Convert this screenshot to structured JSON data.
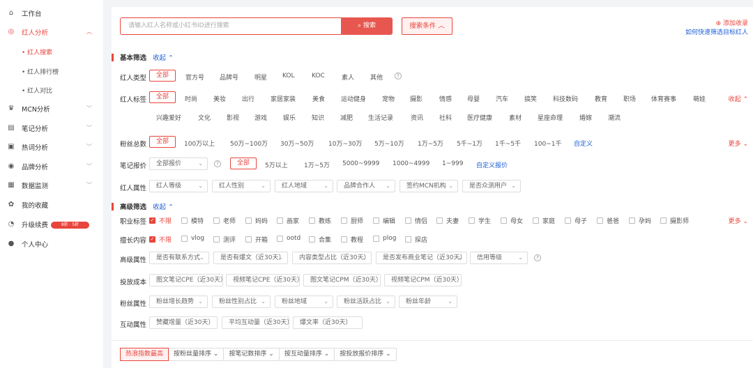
{
  "sidebar": {
    "items": [
      {
        "label": "工作台",
        "icon": "home-icon"
      },
      {
        "label": "红人分析",
        "icon": "target-icon"
      },
      {
        "label": "MCN分析",
        "icon": "crown-icon"
      },
      {
        "label": "笔记分析",
        "icon": "note-icon"
      },
      {
        "label": "热词分析",
        "icon": "fire-icon"
      },
      {
        "label": "品牌分析",
        "icon": "brand-icon"
      },
      {
        "label": "数据监测",
        "icon": "monitor-icon"
      },
      {
        "label": "我的收藏",
        "icon": "star-icon"
      },
      {
        "label": "升级续费",
        "icon": "upgrade-icon"
      },
      {
        "label": "个人中心",
        "icon": "user-icon"
      }
    ],
    "sub_items": [
      "• 红人搜索",
      "• 红人排行榜",
      "• 红人对比"
    ],
    "badge": "8折 · 5折"
  },
  "search": {
    "placeholder": "请输入红人名称或小红书ID进行搜索",
    "button": "⌕ 搜索",
    "condition_button": "搜索条件",
    "add_fav": "⊕ 添加收录",
    "quick_link": "如何快速筛选目标红人"
  },
  "basic": {
    "title": "基本筛选",
    "fold": "收起 ⌃",
    "type": {
      "label": "红人类型",
      "options": [
        "全部",
        "官方号",
        "品牌号",
        "明星",
        "KOL",
        "KOC",
        "素人",
        "其他"
      ]
    },
    "tag": {
      "label": "红人标签",
      "row1": [
        "全部",
        "时尚",
        "美妆",
        "出行",
        "家居家装",
        "美食",
        "运动健身",
        "宠物",
        "摄影",
        "情感",
        "母婴",
        "汽车",
        "搞笑",
        "科技数码",
        "教育",
        "职场",
        "体育赛事",
        "萌娃"
      ],
      "row2": [
        "兴趣爱好",
        "文化",
        "影视",
        "游戏",
        "娱乐",
        "知识",
        "减肥",
        "生活记录",
        "资讯",
        "社科",
        "医疗健康",
        "素材",
        "星座命理",
        "婚嫁",
        "潮流"
      ],
      "fold": "收起 ⌃"
    },
    "fans": {
      "label": "粉丝总数",
      "options": [
        "全部",
        "100万以上",
        "50万~100万",
        "30万~50万",
        "10万~30万",
        "5万~10万",
        "1万~5万",
        "5千~1万",
        "1千~5千",
        "100~1千"
      ],
      "custom": "自定义",
      "more": "更多 ⌄"
    },
    "price": {
      "label": "笔记报价",
      "select": "全部报价",
      "options": [
        "全部",
        "5万以上",
        "1万~5万",
        "5000~9999",
        "1000~4999",
        "1~999"
      ],
      "custom": "自定义报价"
    },
    "attr": {
      "label": "红人属性",
      "selects": [
        "红人等级",
        "红人性别",
        "红人地域",
        "品牌合作人",
        "签约MCN机构",
        "是否众测用户"
      ]
    }
  },
  "advanced": {
    "title": "高级筛选",
    "fold": "收起 ⌃",
    "job": {
      "label": "职业标签",
      "options": [
        "不限",
        "模特",
        "老师",
        "妈妈",
        "画家",
        "教练",
        "厨师",
        "编辑",
        "情侣",
        "夫妻",
        "学生",
        "母女",
        "家庭",
        "母子",
        "爸爸",
        "孕妈",
        "摄影师"
      ],
      "more": "更多 ⌄"
    },
    "content": {
      "label": "擅长内容",
      "options": [
        "不限",
        "vlog",
        "测评",
        "开箱",
        "ootd",
        "合集",
        "教程",
        "plog",
        "探店"
      ]
    },
    "adv_attr": {
      "label": "高级属性",
      "selects": [
        "是否有联系方式",
        "是否有爆文（近30天）",
        "内容类型占比（近30天）",
        "是否发布商业笔记（近30天）",
        "信用等级"
      ]
    },
    "cost": {
      "label": "投放成本",
      "inputs": [
        "图文笔记CPE（近30天）",
        "视频笔记CPE（近30天）",
        "图文笔记CPM（近30天）",
        "视频笔记CPM（近30天）"
      ]
    },
    "fans_attr": {
      "label": "粉丝属性",
      "selects": [
        "粉丝增长趋势",
        "粉丝性别占比",
        "粉丝地域",
        "粉丝活跃占比",
        "粉丝年龄"
      ]
    },
    "interact": {
      "label": "互动属性",
      "inputs": [
        "赞藏增量（近30天）",
        "平均互动量（近30天）",
        "爆文率（近30天）"
      ]
    }
  },
  "sort": [
    "热浪指数最高",
    "按粉丝量排序 ⌄",
    "按笔记数排序 ⌄",
    "按互动量排序 ⌄",
    "按投放报价排序 ⌄"
  ]
}
